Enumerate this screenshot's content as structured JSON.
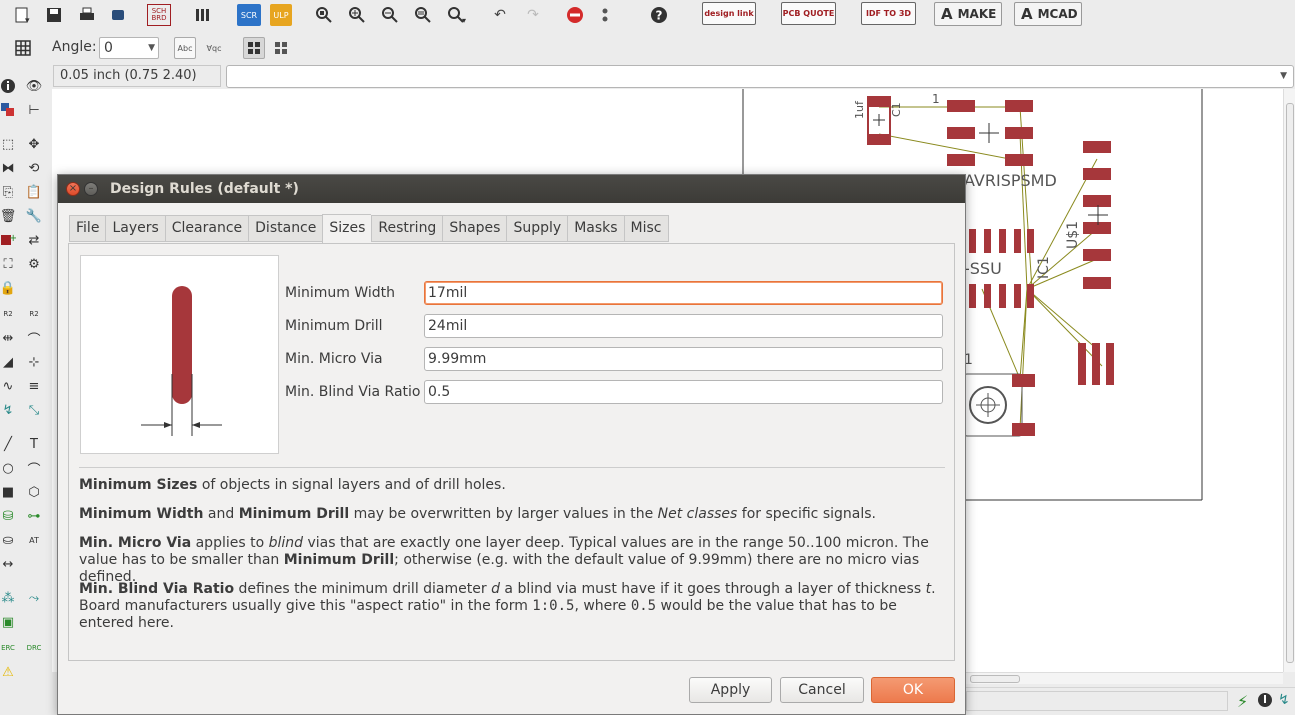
{
  "toolbar": {
    "angle_label": "Angle:",
    "angle_value": "0",
    "abc_toggle": "Abc",
    "abc_mirror_toggle": "Ɐqc",
    "logos": {
      "design_link": "design link",
      "pcb_quote": "PCB QUOTE",
      "idf_to_3d": "IDF TO 3D"
    },
    "make_label": "MAKE",
    "mcad_label": "MCAD",
    "sch_brd_label": "SCH BRD",
    "scr_label": "SCR",
    "ulp_label": "ULP"
  },
  "coordinate_display": "0.05 inch (0.75 2.40)",
  "command_line": "",
  "dialog": {
    "title": "Design Rules (default *)",
    "tabs": [
      "File",
      "Layers",
      "Clearance",
      "Distance",
      "Sizes",
      "Restring",
      "Shapes",
      "Supply",
      "Masks",
      "Misc"
    ],
    "active_tab": "Sizes",
    "fields": [
      {
        "label": "Minimum Width",
        "value": "17mil"
      },
      {
        "label": "Minimum Drill",
        "value": "24mil"
      },
      {
        "label": "Min. Micro Via",
        "value": "9.99mm"
      },
      {
        "label": "Min. Blind Via Ratio",
        "value": "0.5"
      }
    ],
    "help": {
      "p1_bold": "Minimum Sizes",
      "p1_rest": " of objects in signal layers and of drill holes.",
      "p2_bold1": "Minimum Width",
      "p2_and": " and ",
      "p2_bold2": "Minimum Drill",
      "p2_mid": " may be overwritten by larger values in the ",
      "p2_italic": "Net classes",
      "p2_end": " for specific signals.",
      "p3_bold1": "Min. Micro Via",
      "p3_a": " applies to ",
      "p3_italic": "blind",
      "p3_b": " vias that are exactly one layer deep. Typical values are in the range 50..100 micron. The value has to be smaller than ",
      "p3_bold2": "Minimum Drill",
      "p3_c": "; otherwise (e.g. with the default value of 9.99mm) there are no micro vias defined.",
      "p4_bold": "Min. Blind Via Ratio",
      "p4_a": " defines the minimum drill diameter ",
      "p4_d": "d",
      "p4_b": " a blind via must have if it goes through a layer of thickness ",
      "p4_t": "t",
      "p4_c": ". Board manufacturers usually give this \"aspect ratio\" in the form ",
      "p4_mono1": "1:0.5",
      "p4_d2": ", where ",
      "p4_mono2": "0.5",
      "p4_e": " would be the value that has to be entered here."
    },
    "buttons": {
      "apply": "Apply",
      "cancel": "Cancel",
      "ok": "OK"
    }
  },
  "board_labels": {
    "c1_value": "1uf",
    "c1_name": "C1",
    "avrisp": "AVRISPSMD",
    "ic1": "IC1",
    "us1": "U$1",
    "ssu": "-SSU",
    "one": "1",
    "s1": "1"
  },
  "colors": {
    "pad": "#a6373b",
    "airwire": "#8a8a1e",
    "ok_button": "#ef7c4f",
    "title_bar": "#3c3b37"
  }
}
